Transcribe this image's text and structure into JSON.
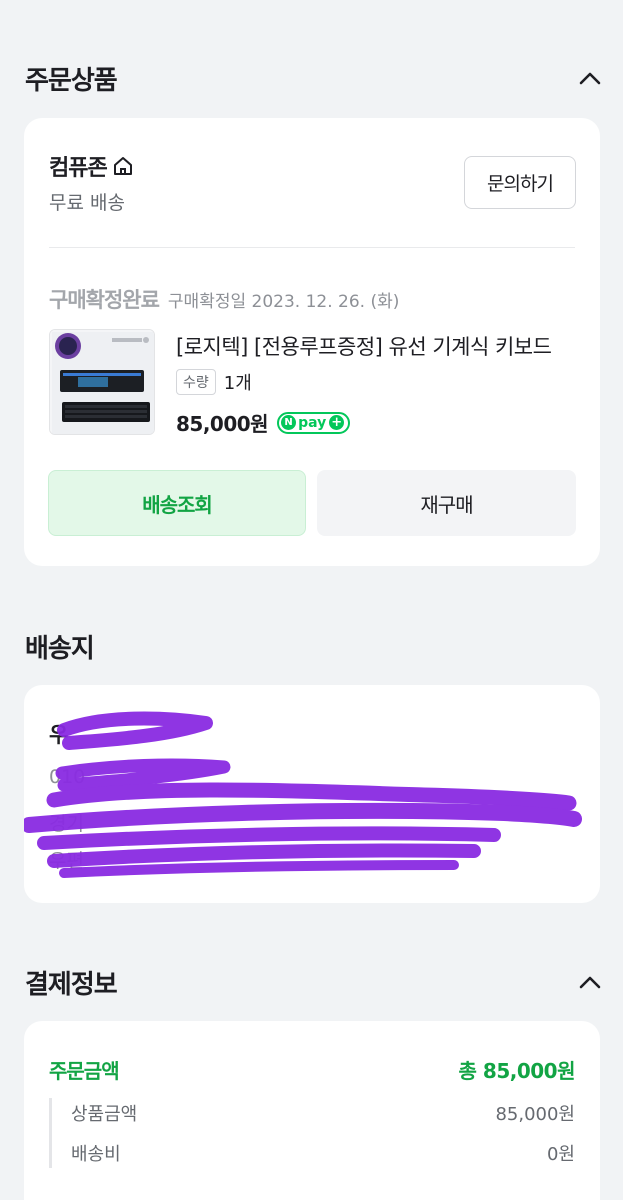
{
  "order_section": {
    "title": "주문상품",
    "store": {
      "name": "컴퓨존",
      "shipping": "무료 배송",
      "inquiry_label": "문의하기"
    },
    "status": "구매확정완료",
    "confirm_date": "구매확정일 2023. 12. 26. (화)",
    "product": {
      "name": "[로지텍] [전용루프증정] 유선 기계식 키보드",
      "qty_label": "수량",
      "qty_value": "1개",
      "price": "85,000원",
      "npay_label": "pay"
    },
    "track_label": "배송조회",
    "rebuy_label": "재구매"
  },
  "shipping_section": {
    "title": "배송지",
    "lines": [
      "우",
      "010",
      "경기",
      "우편"
    ]
  },
  "payment_section": {
    "title": "결제정보",
    "total_label": "주문금액",
    "total_value": "총 85,000원",
    "items": [
      {
        "label": "상품금액",
        "value": "85,000원"
      },
      {
        "label": "배송비",
        "value": "0원"
      }
    ]
  },
  "colors": {
    "accent_green": "#12a444",
    "npay_green": "#03c75a",
    "background": "#f1f3f5",
    "redaction_purple": "#8a2be2"
  }
}
